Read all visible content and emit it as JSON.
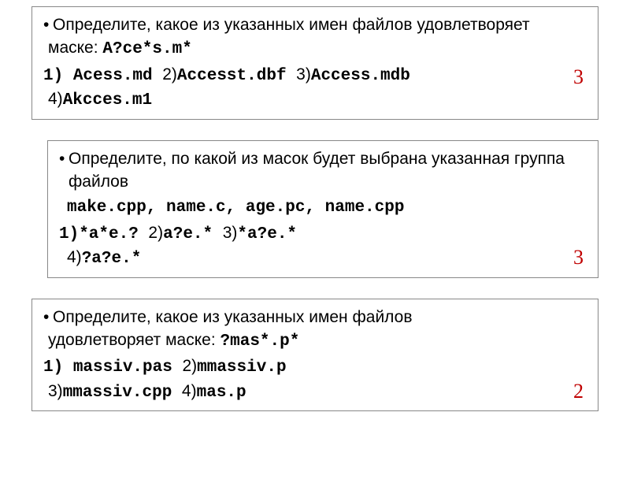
{
  "card1": {
    "text": "Определите, какое из указанных имен файлов удовлетворяет",
    "text2_a": "маске: ",
    "text2_b": "A?ce*s.m*",
    "c1a": "1) ",
    "c1b": " Acess.md  ",
    "c2a": "2)",
    "c2b": "Accesst.dbf   ",
    "c3a": "3)",
    "c3b": "Access.mdb   ",
    "c4a": "4)",
    "c4b": "Akcces.m1",
    "answer": "3"
  },
  "card2": {
    "text": "Определите, по какой из масок будет выбрана указанная группа файлов",
    "files": "make.cpp, name.c, age.pc, name.cpp",
    "c1": "1)*a*e.?    ",
    "c2a": "2)",
    "c2b": "a?e.*   ",
    "c3a": "3)",
    "c3b": "*a?e.*   ",
    "c4a": "4)",
    "c4b": "?a?e.*",
    "answer": "3"
  },
  "card3": {
    "text": "Определите, какое из указанных имен файлов",
    "text2a": "удовлетворяет маске: ",
    "text2b": "?mas*.p*",
    "c1a": "1) ",
    "c1b": " massiv.pas  ",
    "c2a": "2)",
    "c2b": "mmassiv.p",
    "c3a": "3)",
    "c3b": "mmassiv.cpp   ",
    "c4a": "4)",
    "c4b": "mas.p",
    "answer": "2"
  }
}
